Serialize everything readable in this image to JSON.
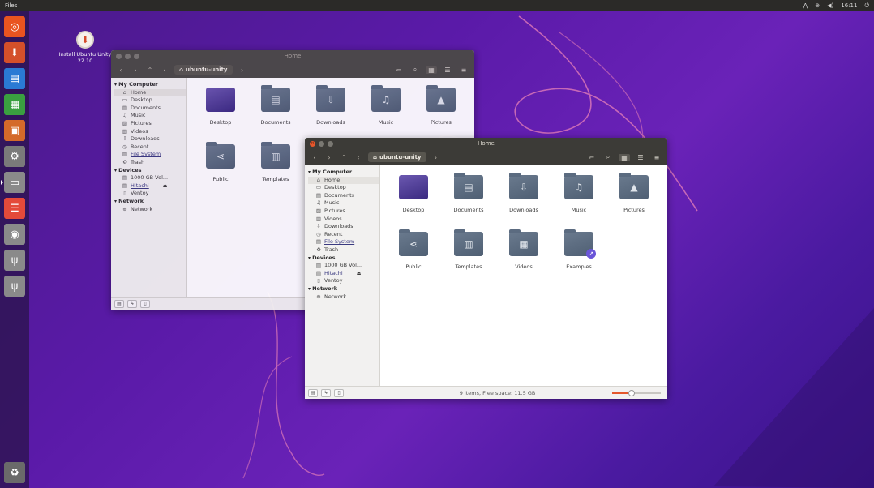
{
  "top_panel": {
    "app_name": "Files",
    "time": "16:11",
    "tray_icons": [
      "network-icon",
      "accessibility-icon",
      "volume-icon"
    ]
  },
  "launcher": {
    "items": [
      {
        "name": "dash-icon",
        "glyph": "◎",
        "color": "#e95420"
      },
      {
        "name": "installer-icon",
        "glyph": "⬇",
        "color": "#d4502a"
      },
      {
        "name": "writer-icon",
        "glyph": "▤",
        "color": "#2a7ad4"
      },
      {
        "name": "calc-icon",
        "glyph": "▦",
        "color": "#3aa040"
      },
      {
        "name": "impress-icon",
        "glyph": "▣",
        "color": "#d46a2a"
      },
      {
        "name": "settings-icon",
        "glyph": "⚙",
        "color": "#7a7a7a"
      },
      {
        "name": "files-icon",
        "glyph": "▭",
        "color": "#8a8a8a",
        "active": true
      },
      {
        "name": "software-icon",
        "glyph": "☰",
        "color": "#e44a3a"
      },
      {
        "name": "disk-icon",
        "glyph": "◉",
        "color": "#8a8a8a"
      },
      {
        "name": "usb-icon",
        "glyph": "ψ",
        "color": "#8a8a8a"
      },
      {
        "name": "usb-icon-2",
        "glyph": "ψ",
        "color": "#8a8a8a"
      }
    ],
    "trash_glyph": "♻"
  },
  "desktop_icon": {
    "label": "Install Ubuntu Unity 22.10"
  },
  "window_back": {
    "title": "Home",
    "path_label": "ubuntu-unity",
    "status": "9 items, Free space"
  },
  "window_front": {
    "title": "Home",
    "path_label": "ubuntu-unity",
    "status": "9 items, Free space: 11.5 GB",
    "zoom_level": 0.4
  },
  "sidebar": {
    "computer_header": "My Computer",
    "computer_items": [
      {
        "label": "Home",
        "icon": "⌂",
        "selected": true
      },
      {
        "label": "Desktop",
        "icon": "▭"
      },
      {
        "label": "Documents",
        "icon": "▤"
      },
      {
        "label": "Music",
        "icon": "♫"
      },
      {
        "label": "Pictures",
        "icon": "▨"
      },
      {
        "label": "Videos",
        "icon": "▥"
      },
      {
        "label": "Downloads",
        "icon": "⇩"
      },
      {
        "label": "Recent",
        "icon": "◷"
      },
      {
        "label": "File System",
        "icon": "▤",
        "link": true
      },
      {
        "label": "Trash",
        "icon": "♻"
      }
    ],
    "devices_header": "Devices",
    "device_items": [
      {
        "label": "1000 GB Vol...",
        "icon": "▤"
      },
      {
        "label": "Hitachi",
        "icon": "▤",
        "link": true,
        "eject": "⏏"
      },
      {
        "label": "Ventoy",
        "icon": "▯"
      }
    ],
    "network_header": "Network",
    "network_items": [
      {
        "label": "Network",
        "icon": "⊕"
      }
    ]
  },
  "files": [
    {
      "name": "Desktop",
      "glyph": "",
      "kind": "desktop"
    },
    {
      "name": "Documents",
      "glyph": "▤"
    },
    {
      "name": "Downloads",
      "glyph": "⇩"
    },
    {
      "name": "Music",
      "glyph": "♫"
    },
    {
      "name": "Pictures",
      "glyph": "▲"
    },
    {
      "name": "Public",
      "glyph": "⋖"
    },
    {
      "name": "Templates",
      "glyph": "▥"
    },
    {
      "name": "Videos",
      "glyph": "▦"
    },
    {
      "name": "Examples",
      "glyph": "",
      "badge": "↗"
    }
  ],
  "toolbar_icons": [
    "edit-path-icon",
    "search-icon",
    "grid-view-icon",
    "compact-view-icon",
    "list-view-icon"
  ]
}
